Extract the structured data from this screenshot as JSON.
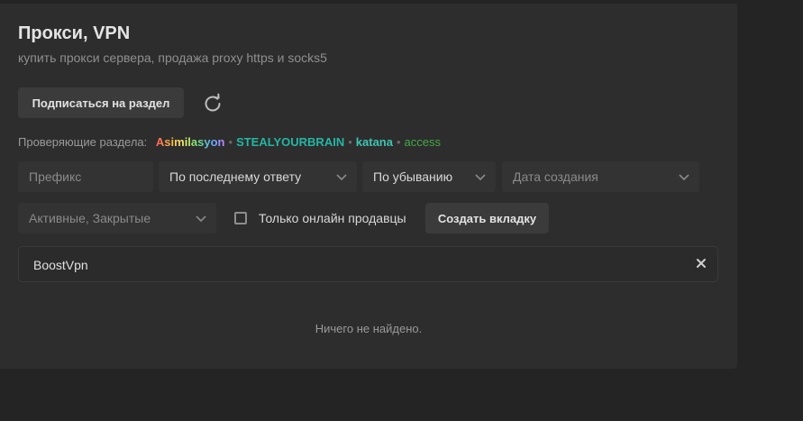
{
  "header": {
    "title": "Прокси, VPN",
    "subtitle": "купить прокси сервера, продажа proxy https и socks5"
  },
  "actions": {
    "subscribe_label": "Подписаться на раздел"
  },
  "moderators": {
    "label": "Проверяющие раздела:",
    "items": [
      "Asimilasyon",
      "STEALYOURBRAIN",
      "katana",
      "access"
    ],
    "separator": "•"
  },
  "filters": {
    "prefix_placeholder": "Префикс",
    "sort_by": "По последнему ответу",
    "order": "По убыванию",
    "date_placeholder": "Дата создания",
    "state": "Активные, Закрытые",
    "online_only_label": "Только онлайн продавцы",
    "create_tab_label": "Создать вкладку"
  },
  "search_tab": {
    "label": "BoostVpn"
  },
  "results": {
    "empty_text": "Ничего не найдено."
  }
}
